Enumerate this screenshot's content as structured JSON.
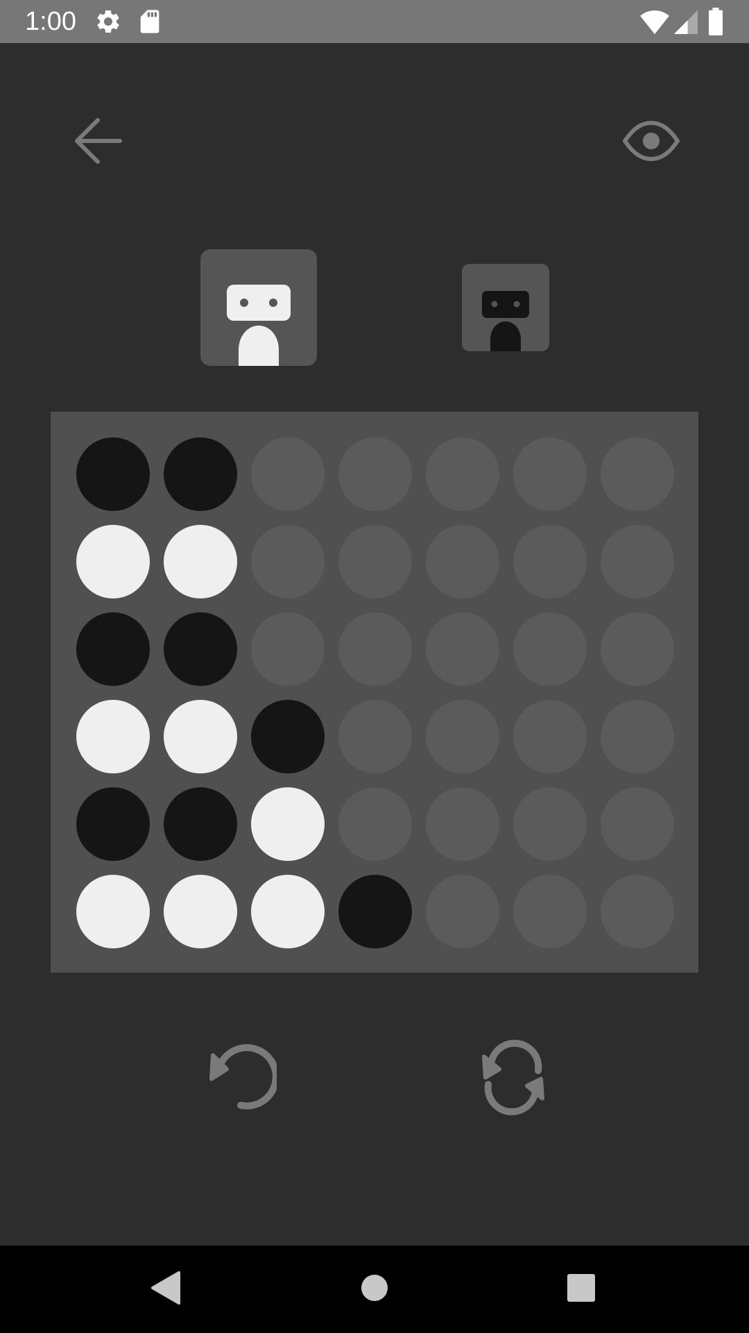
{
  "status_bar": {
    "time": "1:00",
    "icons": [
      "settings-icon",
      "sd-card-icon",
      "wifi-icon",
      "signal-icon",
      "battery-icon"
    ]
  },
  "toolbar": {
    "back_icon": "arrow-left-icon",
    "view_icon": "eye-icon"
  },
  "players": [
    {
      "piece": "white",
      "active": true
    },
    {
      "piece": "black",
      "active": false
    }
  ],
  "board": {
    "columns": 7,
    "rows": 6,
    "cells": [
      [
        "black",
        "black",
        "empty",
        "empty",
        "empty",
        "empty",
        "empty"
      ],
      [
        "white",
        "white",
        "empty",
        "empty",
        "empty",
        "empty",
        "empty"
      ],
      [
        "black",
        "black",
        "empty",
        "empty",
        "empty",
        "empty",
        "empty"
      ],
      [
        "white",
        "white",
        "black",
        "empty",
        "empty",
        "empty",
        "empty"
      ],
      [
        "black",
        "black",
        "white",
        "empty",
        "empty",
        "empty",
        "empty"
      ],
      [
        "white",
        "white",
        "white",
        "black",
        "empty",
        "empty",
        "empty"
      ]
    ]
  },
  "controls": {
    "undo_icon": "undo-icon",
    "restart_icon": "restart-icon"
  },
  "navigation": {
    "back_icon": "nav-back-icon",
    "home_icon": "nav-home-icon",
    "recents_icon": "nav-recents-icon"
  },
  "colors": {
    "background": "#2d2d2d",
    "board": "#505050",
    "empty_slot": "#5b5b5b",
    "black_piece": "#151515",
    "white_piece": "#efefef",
    "icon_gray": "#7a7a7a"
  }
}
